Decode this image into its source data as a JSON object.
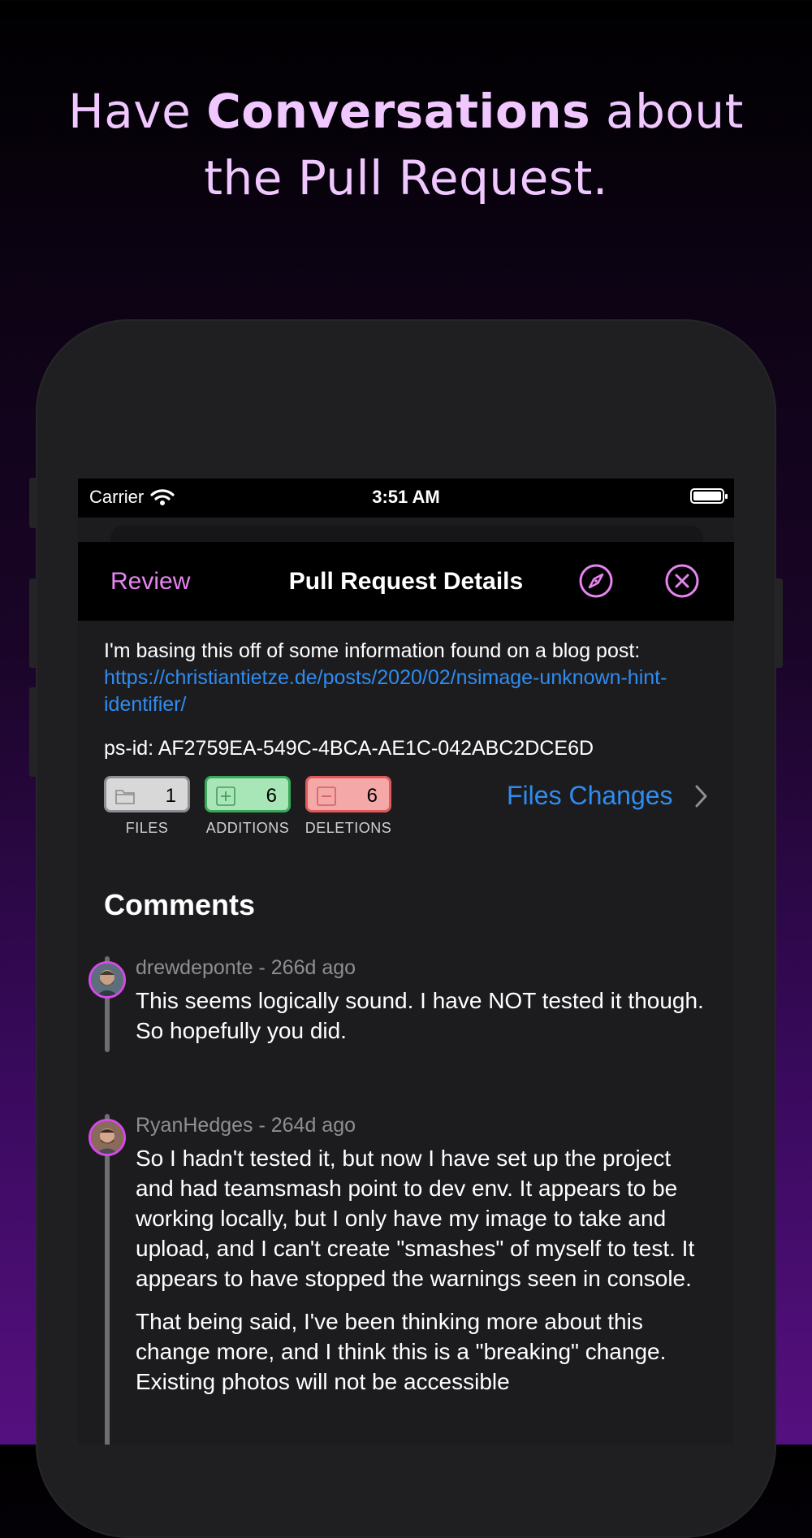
{
  "headline": {
    "pre": "Have ",
    "bold": "Conversations",
    "post": " about",
    "line2": "the Pull Request."
  },
  "status_bar": {
    "carrier": "Carrier",
    "time": "3:51 AM"
  },
  "nav": {
    "left_button": "Review",
    "title": "Pull Request Details",
    "icons": [
      "compass-icon",
      "close-circle-icon"
    ],
    "accent": "#e784f2"
  },
  "description": {
    "text": "I'm basing this off of some information found on a blog post: ",
    "link": "https://christiantietze.de/posts/2020/02/nsimage-unknown-hint-identifier/",
    "ps_id": "ps-id: AF2759EA-549C-4BCA-AE1C-042ABC2DCE6D"
  },
  "stats": {
    "files": {
      "value": "1",
      "label": "FILES",
      "color": "#d8d8d8"
    },
    "additions": {
      "value": "6",
      "label": "ADDITIONS",
      "color": "#a8e6b8"
    },
    "deletions": {
      "value": "6",
      "label": "DELETIONS",
      "color": "#f5a8a8"
    },
    "files_changes_link": "Files Changes"
  },
  "comments": {
    "title": "Comments",
    "items": [
      {
        "author_meta": "drewdeponte - 266d ago",
        "paragraphs": [
          "This seems logically sound. I have NOT tested it though. So hopefully you did."
        ]
      },
      {
        "author_meta": "RyanHedges - 264d ago",
        "paragraphs": [
          "So I hadn't tested it, but now I have set up the project and had teamsmash point to dev env. It appears to be working locally, but I only have my image to take and upload, and I can't create \"smashes\" of myself to test. It appears to have stopped the warnings seen in console.",
          "That being said, I've been thinking more about this change more, and I think this is a \"breaking\" change. Existing photos will not be accessible"
        ]
      }
    ]
  }
}
